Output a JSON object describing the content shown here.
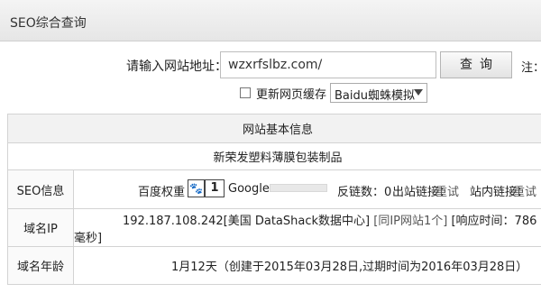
{
  "header": {
    "title": "SEO综合查询"
  },
  "search": {
    "label": "请输入网站地址：",
    "value": "wzxrfslbz.com/",
    "button_label": "查询",
    "note": "注："
  },
  "options": {
    "cache_label": "更新网页缓存",
    "cache_checked": false,
    "spider_selected": "Baidu蜘蛛模拟"
  },
  "table": {
    "heading": "网站基本信息",
    "site_name": "新荣发塑料薄膜包装制品",
    "seo": {
      "label": "SEO信息",
      "baidu_weight_label": "百度权重",
      "paw_icon": "🐾",
      "baidu_weight_value": "1",
      "google_label": "Google",
      "backlinks": "反链数：0",
      "outbound_label": "出站链接：",
      "outbound_link": "重试",
      "inbound_label": "站内链接：",
      "inbound_link": "重试"
    },
    "ip": {
      "label": "域名IP",
      "value": "192.187.108.242[美国 DataShack数据中心]",
      "same_ip": "[同IP网站1个]",
      "response": "[响应时间：786毫秒]"
    },
    "age": {
      "label": "域名年龄",
      "value": "1月12天（创建于2015年03月28日,过期时间为2016年03月28日）"
    }
  }
}
